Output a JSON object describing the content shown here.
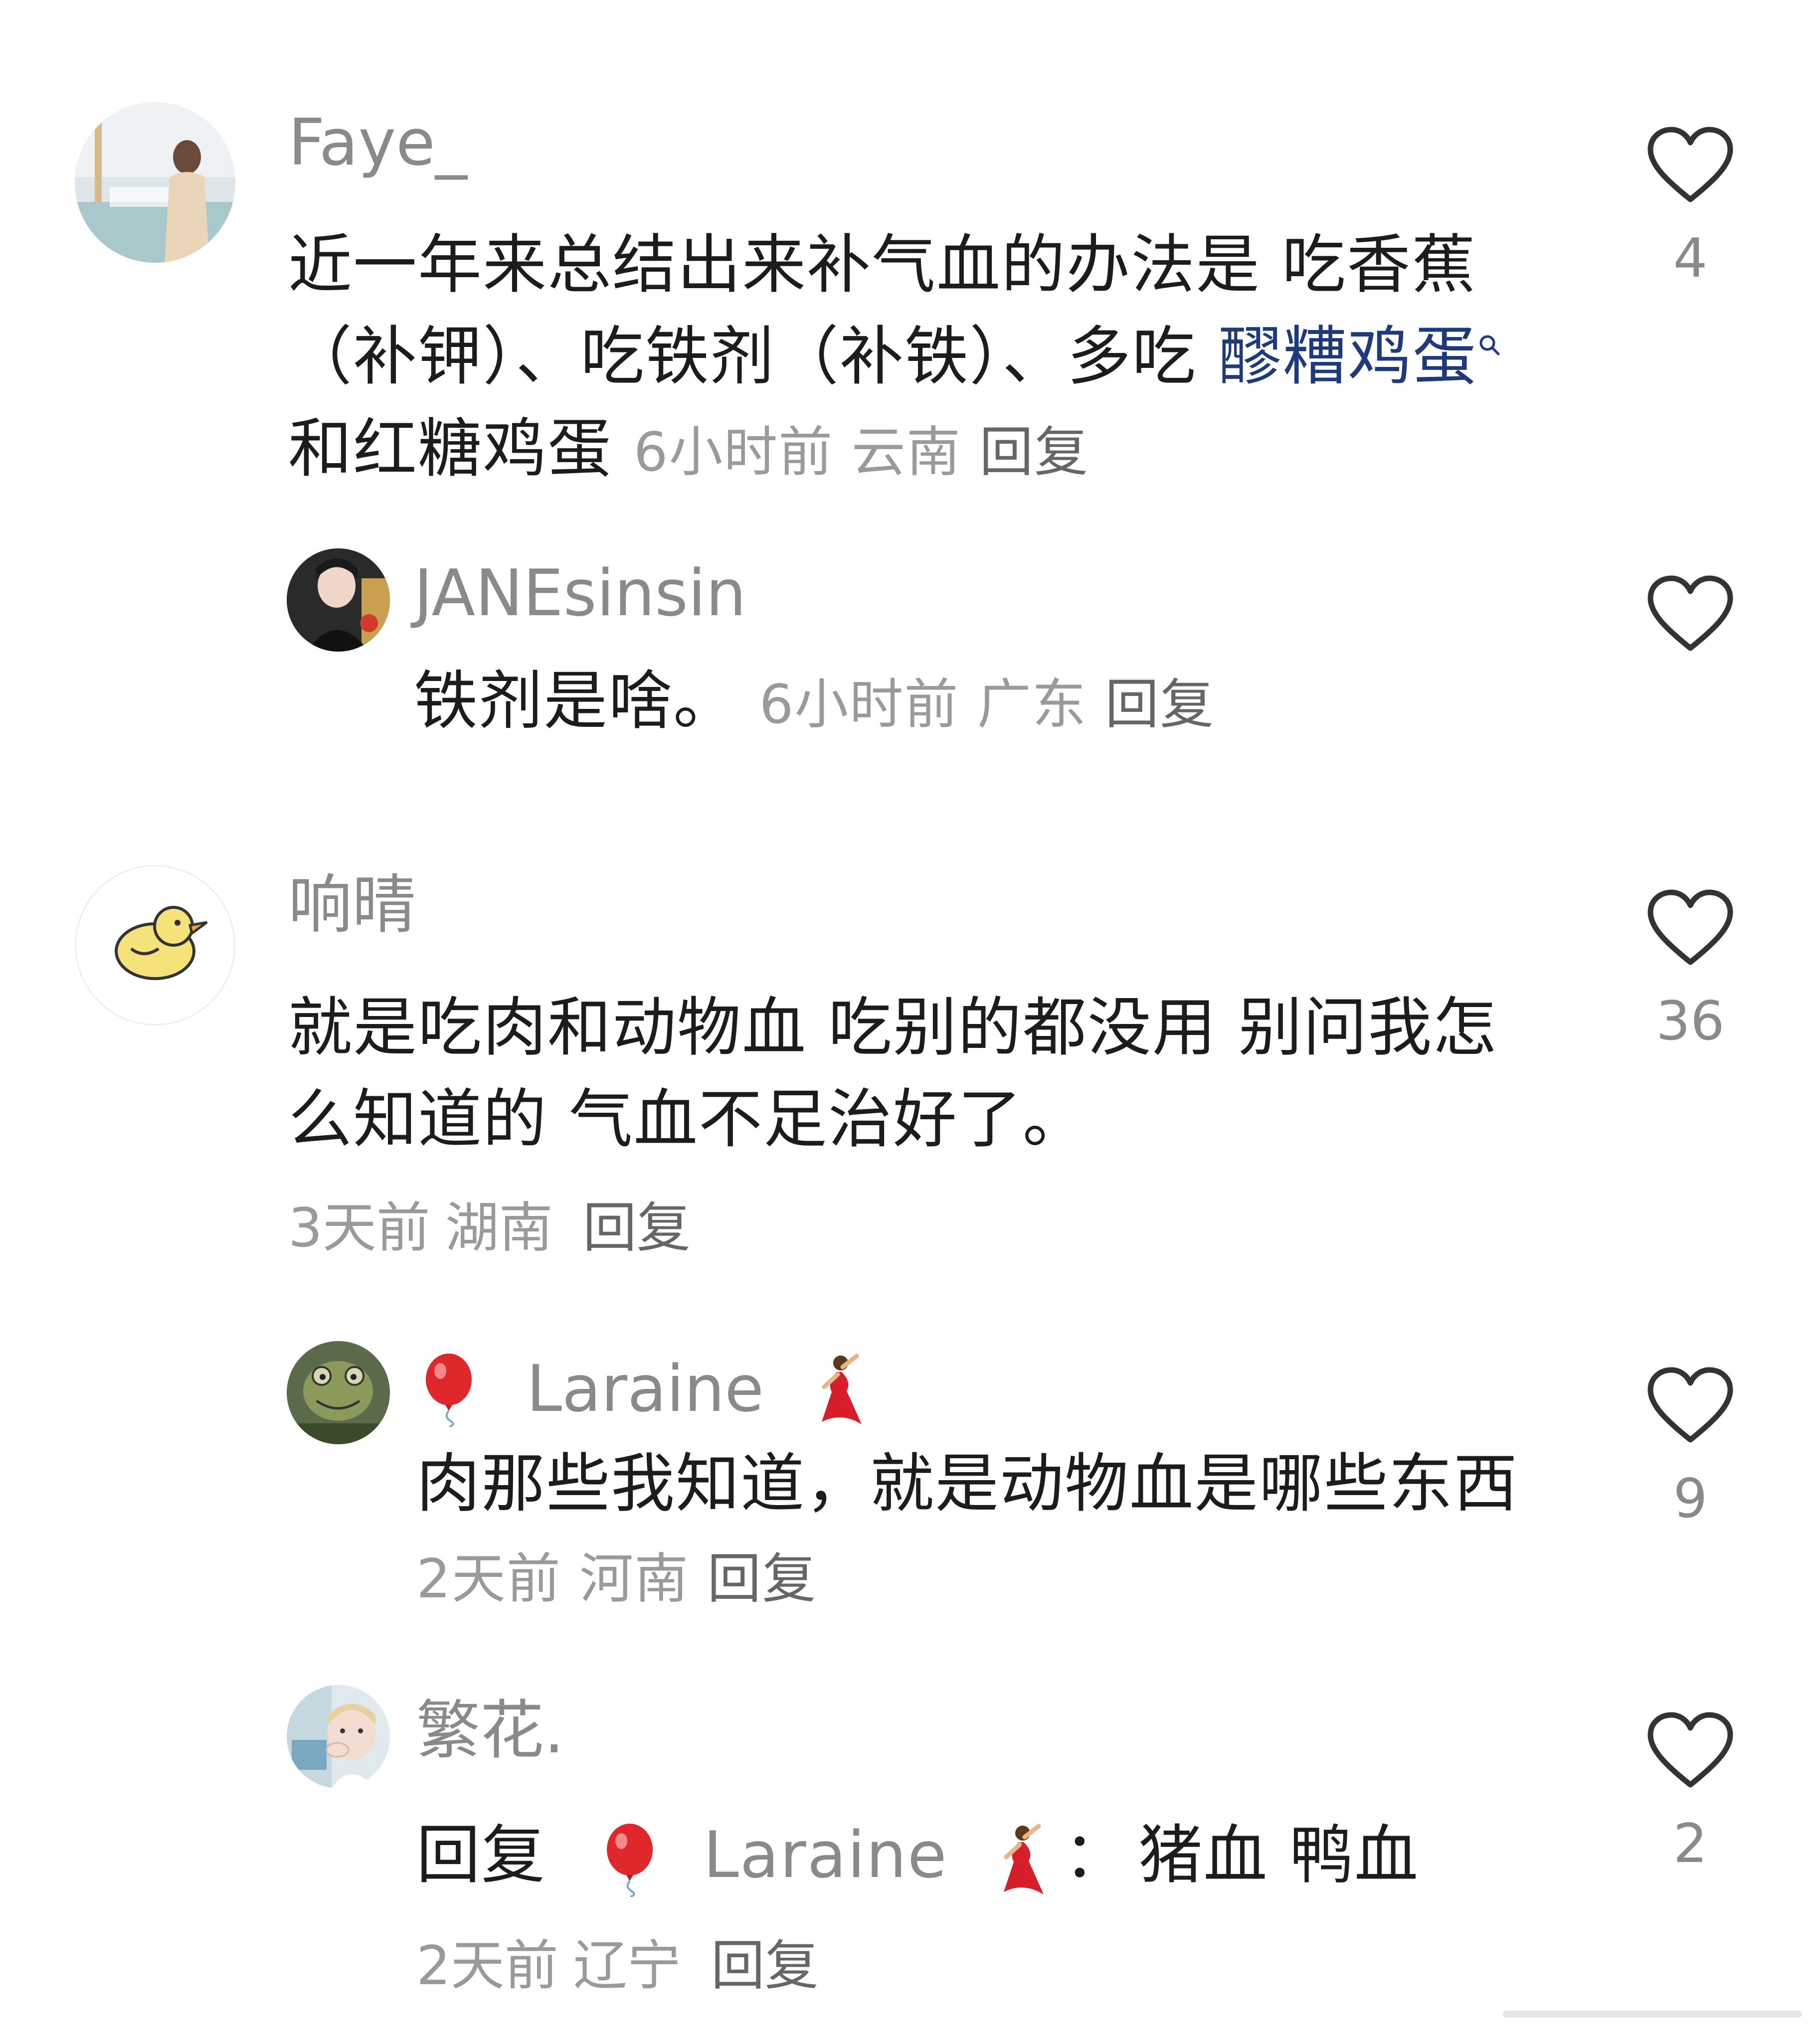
{
  "comments": [
    {
      "user": "Faye_",
      "text_pre": "近一年来总结出来补气血的办法是 吃香蕉（补钾）、吃铁剂（补铁）、多吃 ",
      "text_link": "醪糟鸡蛋",
      "text_post": " 和红糖鸡蛋 ",
      "time": "6小时前",
      "location": "云南",
      "reply_label": "回复",
      "likes": "4"
    },
    {
      "user": "JANEsinsin",
      "text": "铁剂是啥。",
      "time": "6小时前",
      "location": "广东",
      "reply_label": "回复"
    },
    {
      "user": "响晴",
      "text": "就是吃肉和动物血 吃别的都没用 别问我怎么知道的 气血不足治好了。",
      "time": "3天前",
      "location": "湖南",
      "reply_label": "回复",
      "likes": "36"
    },
    {
      "user": "Laraine",
      "text": "肉那些我知道，就是动物血是哪些东西",
      "time": "2天前",
      "location": "河南",
      "reply_label": "回复",
      "likes": "9"
    },
    {
      "user": "繁花.",
      "reply_prefix": "回复",
      "reply_to": "Laraine",
      "text": "猪血 鸭血",
      "time": "2天前",
      "location": "辽宁",
      "reply_label": "回复",
      "likes": "2"
    }
  ],
  "icons": {
    "like": "heart-outline-icon",
    "balloon": "red-balloon-emoji",
    "dancer": "dancer-emoji",
    "search": "search-mini-icon"
  },
  "colors": {
    "username": "#8a8a8a",
    "text": "#1c1c1c",
    "meta": "#9a9a9a",
    "link": "#1f3a7a",
    "heart": "#333333"
  }
}
